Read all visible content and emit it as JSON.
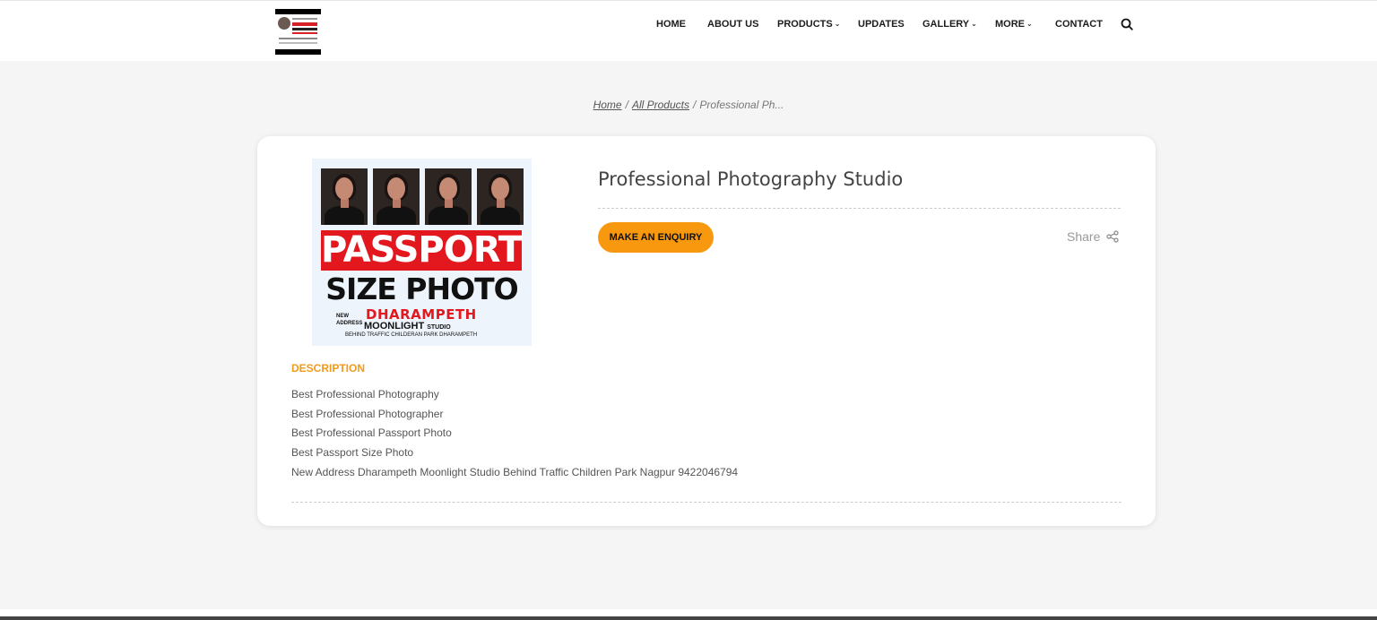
{
  "header": {
    "nav": [
      {
        "label": "HOME",
        "dropdown": false
      },
      {
        "label": "ABOUT US",
        "dropdown": false
      },
      {
        "label": "PRODUCTS",
        "dropdown": true
      },
      {
        "label": "UPDATES",
        "dropdown": false
      },
      {
        "label": "GALLERY",
        "dropdown": true
      },
      {
        "label": "MORE",
        "dropdown": true
      },
      {
        "label": "CONTACT",
        "dropdown": false
      }
    ],
    "search_icon": "search-icon"
  },
  "breadcrumb": {
    "home": "Home",
    "all_products": "All Products",
    "current": "Professional Ph...",
    "separator": "/"
  },
  "product": {
    "title": "Professional Photography Studio",
    "enquiry_button": "MAKE AN ENQUIRY",
    "share_label": "Share",
    "image": {
      "headline": "PASSPORT",
      "subheadline": "SIZE PHOTO",
      "new_address_line1": "NEW",
      "new_address_line2": "ADDRESS",
      "location": "DHARAMPETH",
      "studio_name": "MOONLIGHT",
      "studio_suffix": "STUDIO",
      "landmark": "BEHIND TRAFFIC CHILDERAN PARK DHARAMPETH"
    },
    "description_heading": "DESCRIPTION",
    "description_lines": [
      "Best Professional Photography",
      "Best Professional Photographer",
      "Best Professional Passport Photo",
      "Best Passport Size Photo",
      "New Address Dharampeth Moonlight Studio Behind Traffic Children Park Nagpur 9422046794"
    ]
  },
  "colors": {
    "accent": "#f8980e",
    "description_heading": "#f29a1c",
    "banner_red": "#e3181f",
    "page_bg": "#f5f5f5"
  }
}
